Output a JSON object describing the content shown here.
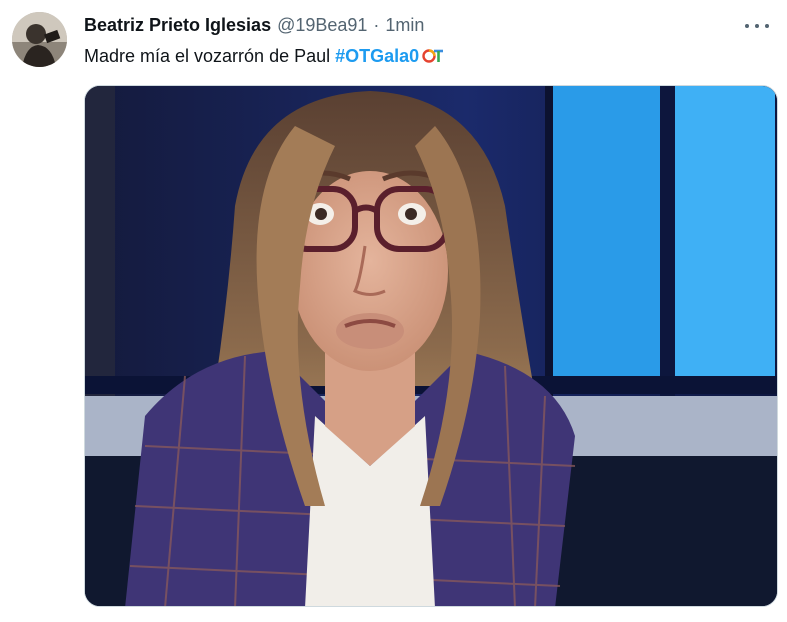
{
  "author": {
    "display_name": "Beatriz Prieto Iglesias",
    "handle": "@19Bea91",
    "separator": "·",
    "time": "1min",
    "avatar_icon": "profile-avatar"
  },
  "tweet": {
    "text": "Madre mía el vozarrón de Paul",
    "hashtag": "#OTGala0",
    "hashtag_emoji": "ot-logo-icon"
  },
  "actions": {
    "more_icon": "more-horizontal-icon"
  },
  "media": {
    "kind": "photo",
    "subject": "woman-with-glasses-making-face"
  },
  "colors": {
    "hashtag": "#1d9bf0",
    "secondary_text": "#536471",
    "primary_text": "#0f1419",
    "border": "#cfd9de"
  }
}
